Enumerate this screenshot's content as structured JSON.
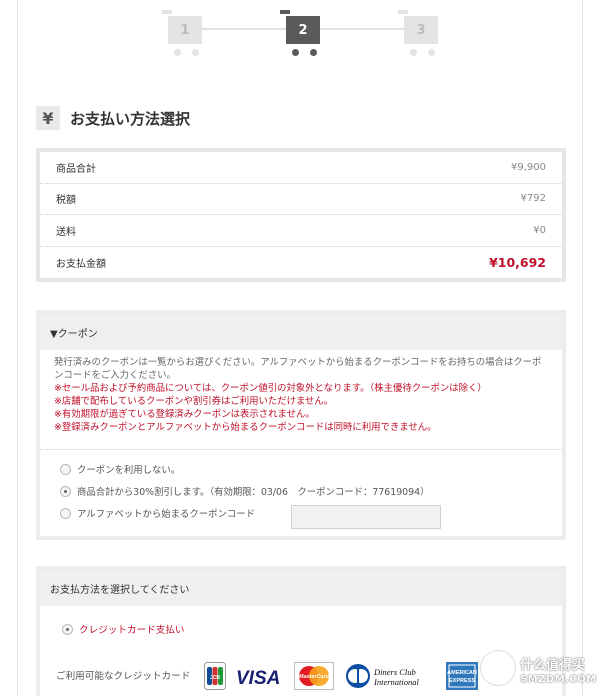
{
  "steps": [
    {
      "number": "1",
      "state": "inactive"
    },
    {
      "number": "2",
      "state": "active"
    },
    {
      "number": "3",
      "state": "inactive"
    }
  ],
  "heading": {
    "icon": "yen-icon",
    "icon_glyph": "¥",
    "title": "お支払い方法選択"
  },
  "summary": {
    "rows": [
      {
        "label": "商品合計",
        "value": "¥9,900"
      },
      {
        "label": "税額",
        "value": "¥792"
      },
      {
        "label": "送料",
        "value": "¥0"
      },
      {
        "label": "お支払金額",
        "value": "¥10,692"
      }
    ]
  },
  "coupon": {
    "title": "▼クーポン",
    "info_gray": "発行済みのクーポンは一覧からお選びください。アルファベットから始まるクーポンコードをお持ちの場合はクーポンコードをご入力ください。",
    "notes": [
      "※セール品および予約商品については、クーポン値引の対象外となります。（株主優待クーポンは除く）",
      "※店舗で配布しているクーポンや割引券はご利用いただけません。",
      "※有効期限が過ぎている登録済みクーポンは表示されません。",
      "※登録済みクーポンとアルファベットから始まるクーポンコードは同時に利用できません。"
    ],
    "options": [
      {
        "label": "クーポンを利用しない。",
        "selected": false
      },
      {
        "label": "商品合計から30%割引します。（有効期限：03/06　クーポンコード：77619094）",
        "selected": true
      },
      {
        "label": "アルファベットから始まるクーポンコード",
        "selected": false
      }
    ],
    "code_input_value": ""
  },
  "payment": {
    "title": "お支払方法を選択してください",
    "option": "クレジットカード支払い",
    "cards_label": "ご利用可能なクレジットカード",
    "cards": [
      {
        "name": "JCB",
        "icon": "jcb-icon"
      },
      {
        "name": "VISA",
        "icon": "visa-icon"
      },
      {
        "name": "MasterCard",
        "icon": "mastercard-icon"
      },
      {
        "name": "Diners Club International",
        "icon": "diners-icon"
      },
      {
        "name": "AMERICAN EXPRESS",
        "icon": "amex-icon"
      }
    ]
  },
  "watermark": {
    "line1": "什么值得买",
    "line2": "SMZDM.COM"
  },
  "colors": {
    "accent_red": "#c0102a",
    "step_active": "#5a5a5a",
    "step_inactive": "#e4e4e4",
    "box_border": "#e6e6e6"
  }
}
